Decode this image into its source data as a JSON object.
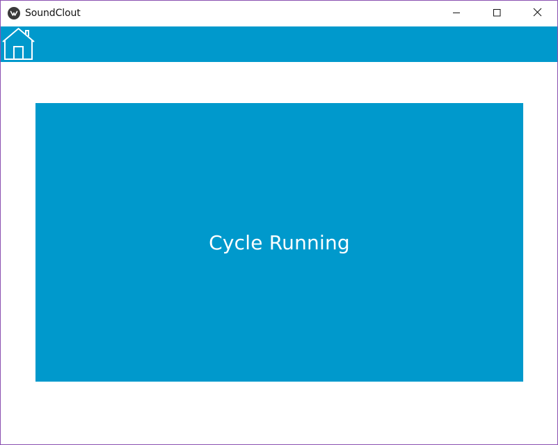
{
  "window": {
    "title": "SoundClout",
    "controls": {
      "minimize": "minimize-icon",
      "maximize": "maximize-icon",
      "close": "close-icon"
    }
  },
  "toolbar": {
    "background": "#0099cc",
    "home_icon": "home-icon"
  },
  "main": {
    "status_text": "Cycle Running",
    "panel_color": "#0099cc"
  }
}
